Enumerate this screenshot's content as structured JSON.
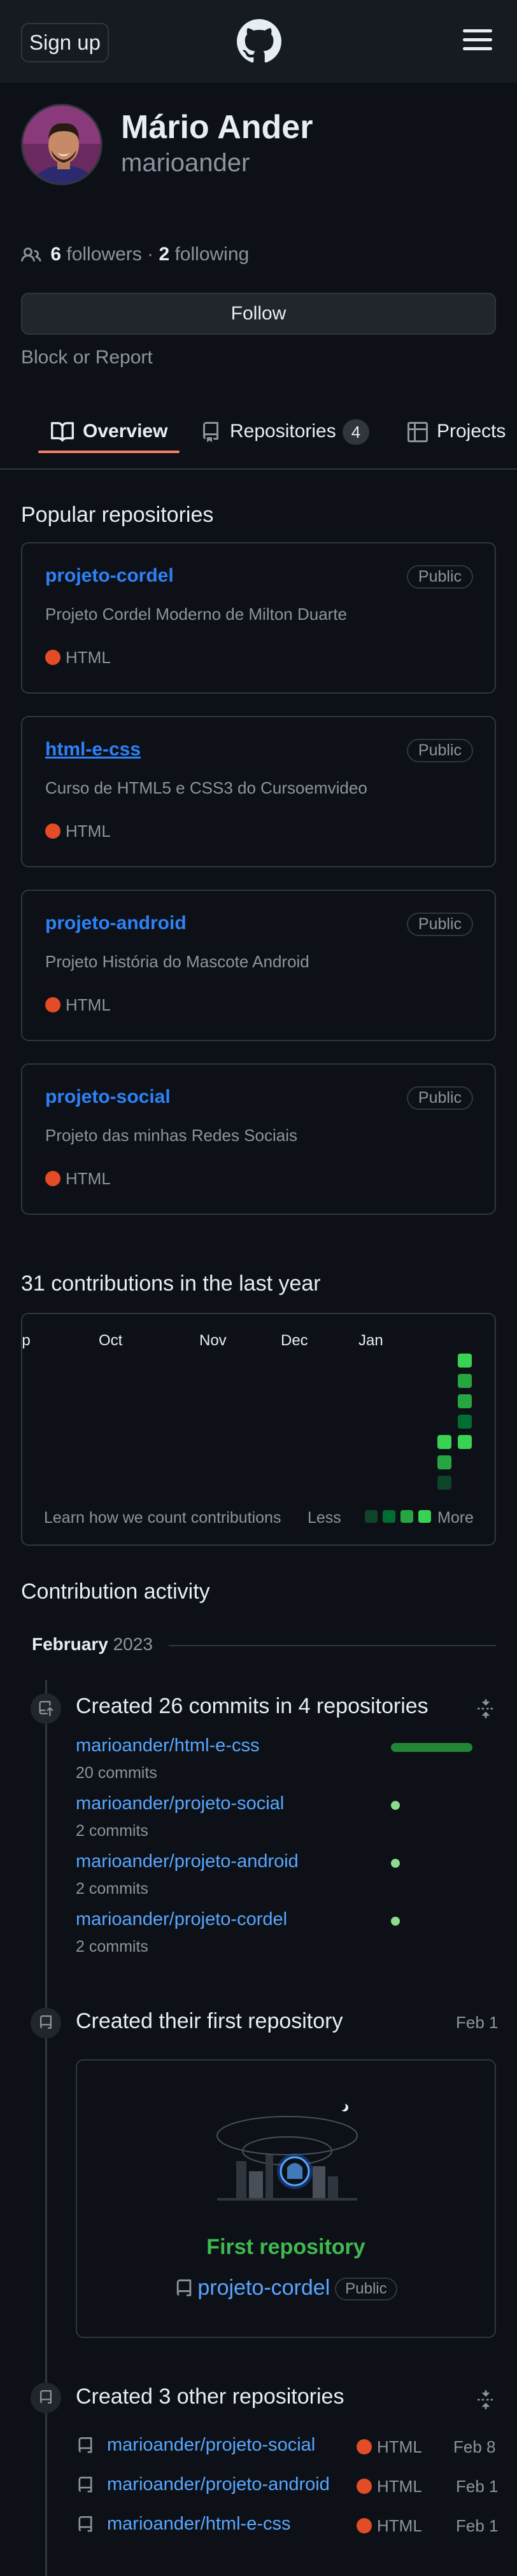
{
  "header": {
    "signup": "Sign up",
    "logo_icon": "github-logo-icon",
    "menu_icon": "hamburger-menu-icon"
  },
  "profile": {
    "name": "Mário Ander",
    "login": "marioander",
    "followers_count": "6",
    "followers_label": "followers",
    "separator": "·",
    "following_count": "2",
    "following_label": "following",
    "follow_button": "Follow",
    "block_report": "Block or Report"
  },
  "tabs": [
    {
      "label": "Overview",
      "icon": "book-icon",
      "active": true
    },
    {
      "label": "Repositories",
      "icon": "repo-icon",
      "count": "4"
    },
    {
      "label": "Projects",
      "icon": "table-icon"
    }
  ],
  "popular": {
    "title": "Popular repositories",
    "repos": [
      {
        "name": "projeto-cordel",
        "visibility": "Public",
        "description": "Projeto Cordel Moderno de Milton Duarte",
        "language": "HTML"
      },
      {
        "name": "html-e-css",
        "visibility": "Public",
        "description": "Curso de HTML5 e CSS3 do Cursoemvideo",
        "language": "HTML"
      },
      {
        "name": "projeto-android",
        "visibility": "Public",
        "description": "Projeto História do Mascote Android",
        "language": "HTML"
      },
      {
        "name": "projeto-social",
        "visibility": "Public",
        "description": "Projeto das minhas Redes Sociais",
        "language": "HTML"
      }
    ],
    "lang_color": "#e34c26"
  },
  "contributions": {
    "title": "31 contributions in the last year",
    "months": [
      "Sep",
      "Oct",
      "Nov",
      "Dec",
      "Jan"
    ],
    "learn": "Learn how we count contributions",
    "less": "Less",
    "more": "More"
  },
  "activity": {
    "title": "Contribution activity",
    "month": "February",
    "year": "2023",
    "commits": {
      "title": "Created 26 commits in 4 repositories",
      "items": [
        {
          "repo": "marioander/html-e-css",
          "count": "20 commits"
        },
        {
          "repo": "marioander/projeto-social",
          "count": "2 commits"
        },
        {
          "repo": "marioander/projeto-android",
          "count": "2 commits"
        },
        {
          "repo": "marioander/projeto-cordel",
          "count": "2 commits"
        }
      ]
    },
    "first_repo": {
      "title": "Created their first repository",
      "date": "Feb 1",
      "label": "First repository",
      "repo": "projeto-cordel",
      "visibility": "Public"
    },
    "other_repos": {
      "title": "Created 3 other repositories",
      "items": [
        {
          "repo": "marioander/projeto-social",
          "language": "HTML",
          "date": "Feb 8"
        },
        {
          "repo": "marioander/projeto-android",
          "language": "HTML",
          "date": "Feb 1"
        },
        {
          "repo": "marioander/html-e-css",
          "language": "HTML",
          "date": "Feb 1"
        }
      ]
    }
  }
}
